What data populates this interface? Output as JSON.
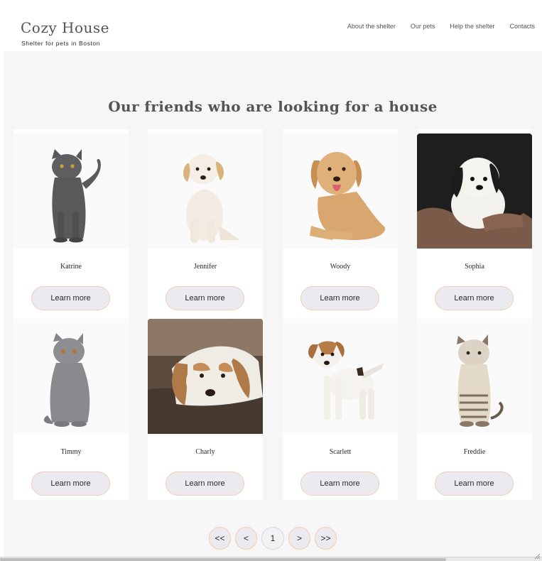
{
  "header": {
    "logo": "Cozy House",
    "tagline": "Shelter for pets in Boston",
    "nav": [
      "About the shelter",
      "Our pets",
      "Help the shelter",
      "Contacts"
    ]
  },
  "main": {
    "title": "Our friends who are looking for a house",
    "button_label": "Learn more",
    "pets": [
      {
        "name": "Katrine",
        "photo": "gray cat"
      },
      {
        "name": "Jennifer",
        "photo": "cream puppy"
      },
      {
        "name": "Woody",
        "photo": "golden retriever"
      },
      {
        "name": "Sophia",
        "photo": "fluffy puppy held in arms"
      },
      {
        "name": "Timmy",
        "photo": "gray british cat"
      },
      {
        "name": "Charly",
        "photo": "brown and white dog lying down"
      },
      {
        "name": "Scarlett",
        "photo": "jack russell puppy"
      },
      {
        "name": "Freddie",
        "photo": "tabby kitten"
      }
    ]
  },
  "pagination": {
    "first": "<<",
    "prev": "<",
    "current": "1",
    "next": ">",
    "last": ">>"
  },
  "colors": {
    "accent_border": "#f1cdb3",
    "section_bg": "#f6f6f6",
    "button_bg": "#ebebef",
    "text_dark": "#292929",
    "text_gray": "#545454"
  }
}
